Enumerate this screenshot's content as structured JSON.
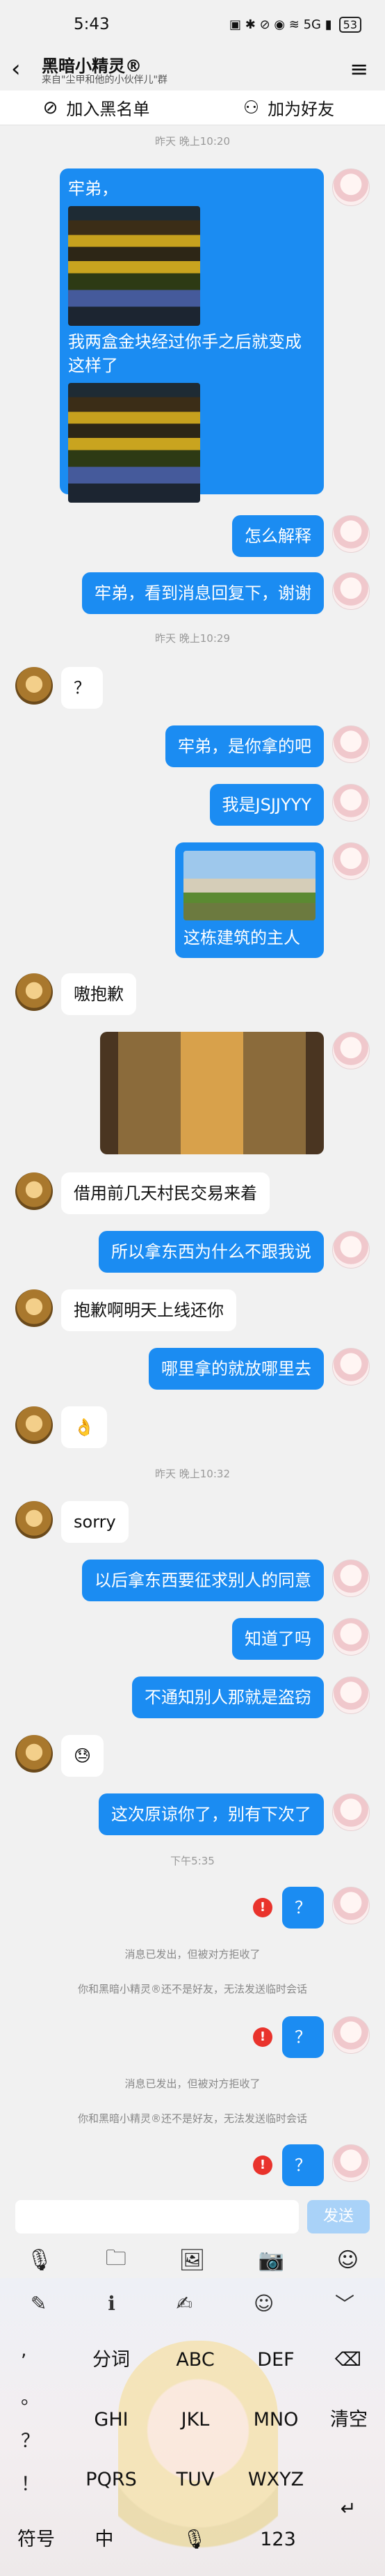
{
  "status_bar": {
    "time": "5:43",
    "icons": "▣ ✱ ⊘ ◉ ≋ 5G ▮",
    "battery": "53"
  },
  "header": {
    "back_icon": "chevron-left",
    "title": "黑暗小精灵®",
    "subtitle": "来自\"尘甲和他的小伙伴儿\"群",
    "menu_icon": "hamburger-menu"
  },
  "actions": {
    "blacklist_label": "加入黑名单",
    "add_friend_label": "加为好友"
  },
  "chat": {
    "ts1": "昨天 晚上10:20",
    "m1_text": "牢弟，",
    "m1_caption": "我两盒金块经过你手之后就变成这样了",
    "m2": "怎么解释",
    "m3": "牢弟，看到消息回复下，谢谢",
    "ts2": "昨天 晚上10:29",
    "o1": "？",
    "m4": "牢弟，是你拿的吧",
    "m5": "我是JSJJYYY",
    "m6_caption": "这栋建筑的主人",
    "o2": "嗷抱歉",
    "o3": "借用前几天村民交易来着",
    "m7": "所以拿东西为什么不跟我说",
    "o4": "抱歉啊明天上线还你",
    "m8": "哪里拿的就放哪里去",
    "o5": "👌",
    "ts3": "昨天 晚上10:32",
    "o6": "sorry",
    "m9": "以后拿东西要征求别人的同意",
    "m10": "知道了吗",
    "m11": "不通知别人那就是盗窃",
    "o7": "😓",
    "m12": "这次原谅你了，别有下次了",
    "ts4": "下午5:35",
    "m13": "？",
    "sys1": "消息已发出，但被对方拒收了",
    "sys2": "你和黑暗小精灵®还不是好友，无法发送临时会话",
    "m14": "？",
    "sys3": "消息已发出，但被对方拒收了",
    "sys4": "你和黑暗小精灵®还不是好友，无法发送临时会话",
    "m15": "？",
    "error_mark": "!"
  },
  "composer": {
    "send_label": "发送"
  },
  "toolbar": {
    "icons": [
      "microphone-icon",
      "folder-icon",
      "image-icon",
      "camera-icon",
      "emoji-icon"
    ]
  },
  "keyboard": {
    "top": [
      "✎",
      "ℹ",
      "✍",
      "☺",
      "﹀"
    ],
    "left_col": [
      ",",
      "。",
      "？",
      "！"
    ],
    "row1": [
      "分词",
      "ABC",
      "DEF"
    ],
    "row2": [
      "GHI",
      "JKL",
      "MNO"
    ],
    "row3": [
      "PQRS",
      "TUV",
      "WXYZ"
    ],
    "delete_icon": "⌫",
    "clear_label": "清空",
    "symbols_label": "符号",
    "lang_label": "中",
    "mic_label": "🎙",
    "num_label": "123",
    "enter_icon": "↵"
  }
}
